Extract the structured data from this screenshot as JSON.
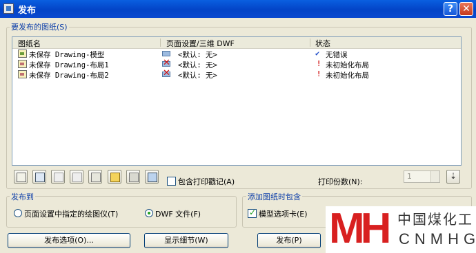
{
  "window": {
    "title": "发布",
    "help_glyph": "?",
    "close_glyph": "✕"
  },
  "sheets_group": {
    "label": "要发布的图纸(S)",
    "columns": [
      "图纸名",
      "页面设置/三维 DWF",
      "状态"
    ],
    "rows": [
      {
        "name": "未保存 Drawing-模型",
        "setup": "<默认: 无>",
        "status_mark": "✔",
        "status": "无错误"
      },
      {
        "name": "未保存 Drawing-布局1",
        "setup": "<默认: 无>",
        "status_mark": "!",
        "status": "未初始化布局"
      },
      {
        "name": "未保存 Drawing-布局2",
        "setup": "<默认: 无>",
        "status_mark": "!",
        "status": "未初始化布局"
      }
    ]
  },
  "toolbar": {
    "icons": [
      "preview-icon",
      "add-sheets-icon",
      "remove-sheets-icon",
      "move-up-icon",
      "move-down-icon",
      "load-list-icon",
      "save-list-icon",
      "plot-stamp-settings-icon"
    ],
    "include_stamp_label": "包含打印戳记(A)",
    "copies_label": "打印份数(N):",
    "copies_value": "1",
    "sort_glyph": "⇣"
  },
  "publish_to": {
    "label": "发布到",
    "option_plotter": "页面设置中指定的绘图仪(T)",
    "option_dwf": "DWF 文件(F)",
    "selected": "dwf"
  },
  "include_when_adding": {
    "label": "添加图纸时包含",
    "model_tab_label": "模型选项卡(E)",
    "model_tab_checked": true
  },
  "buttons": {
    "publish_options": "发布选项(O)...",
    "show_details": "显示细节(W)",
    "publish": "发布(P)"
  },
  "watermark": {
    "logo_letters": "MH",
    "chinese": "中国煤化工",
    "english": "CNMHG"
  }
}
